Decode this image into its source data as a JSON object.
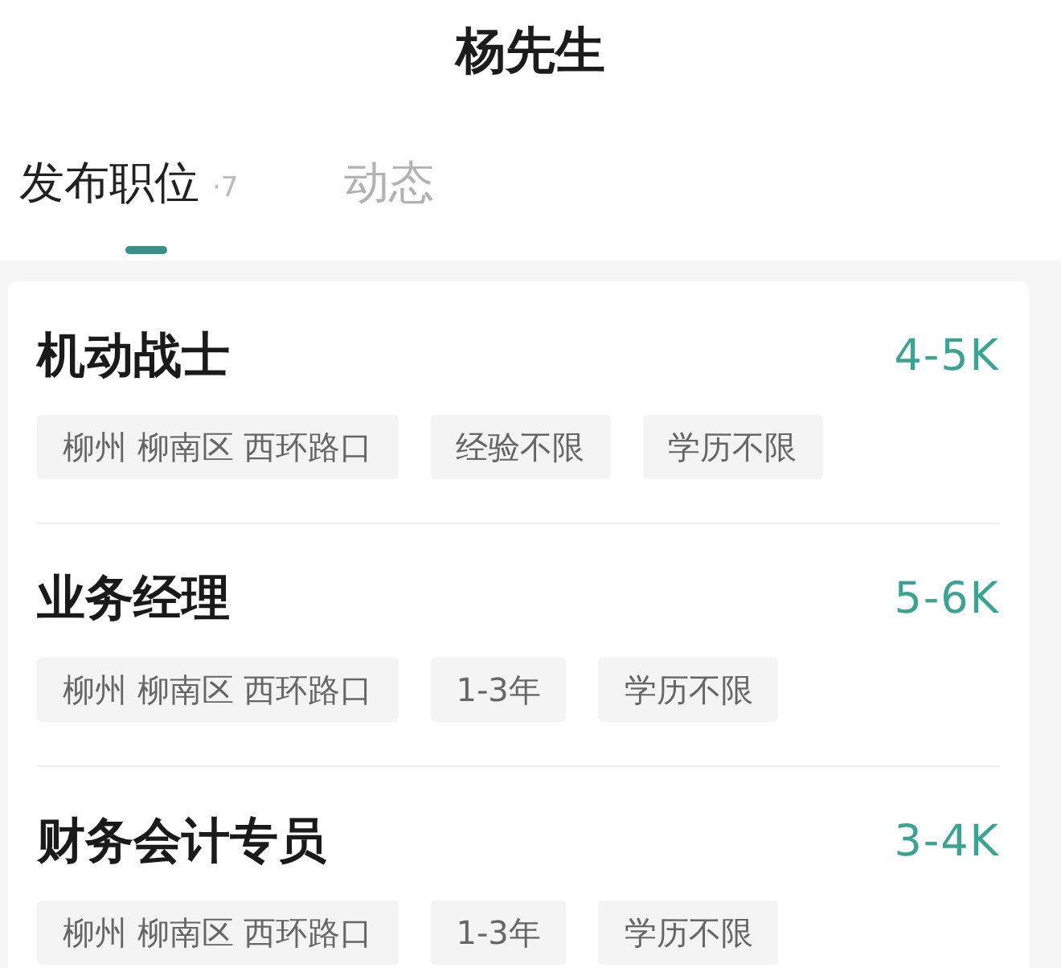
{
  "header": {
    "title": "杨先生"
  },
  "tabs": [
    {
      "label": "发布职位",
      "count": "·7",
      "selected": true
    },
    {
      "label": "动态",
      "selected": false
    }
  ],
  "jobs": [
    {
      "title": "机动战士",
      "salary": "4-5K",
      "tags": [
        "柳州 柳南区 西环路口",
        "经验不限",
        "学历不限"
      ]
    },
    {
      "title": "业务经理",
      "salary": "5-6K",
      "tags": [
        "柳州 柳南区 西环路口",
        "1-3年",
        "学历不限"
      ]
    },
    {
      "title": "财务会计专员",
      "salary": "3-4K",
      "tags": [
        "柳州 柳南区 西环路口",
        "1-3年",
        "学历不限"
      ]
    }
  ]
}
